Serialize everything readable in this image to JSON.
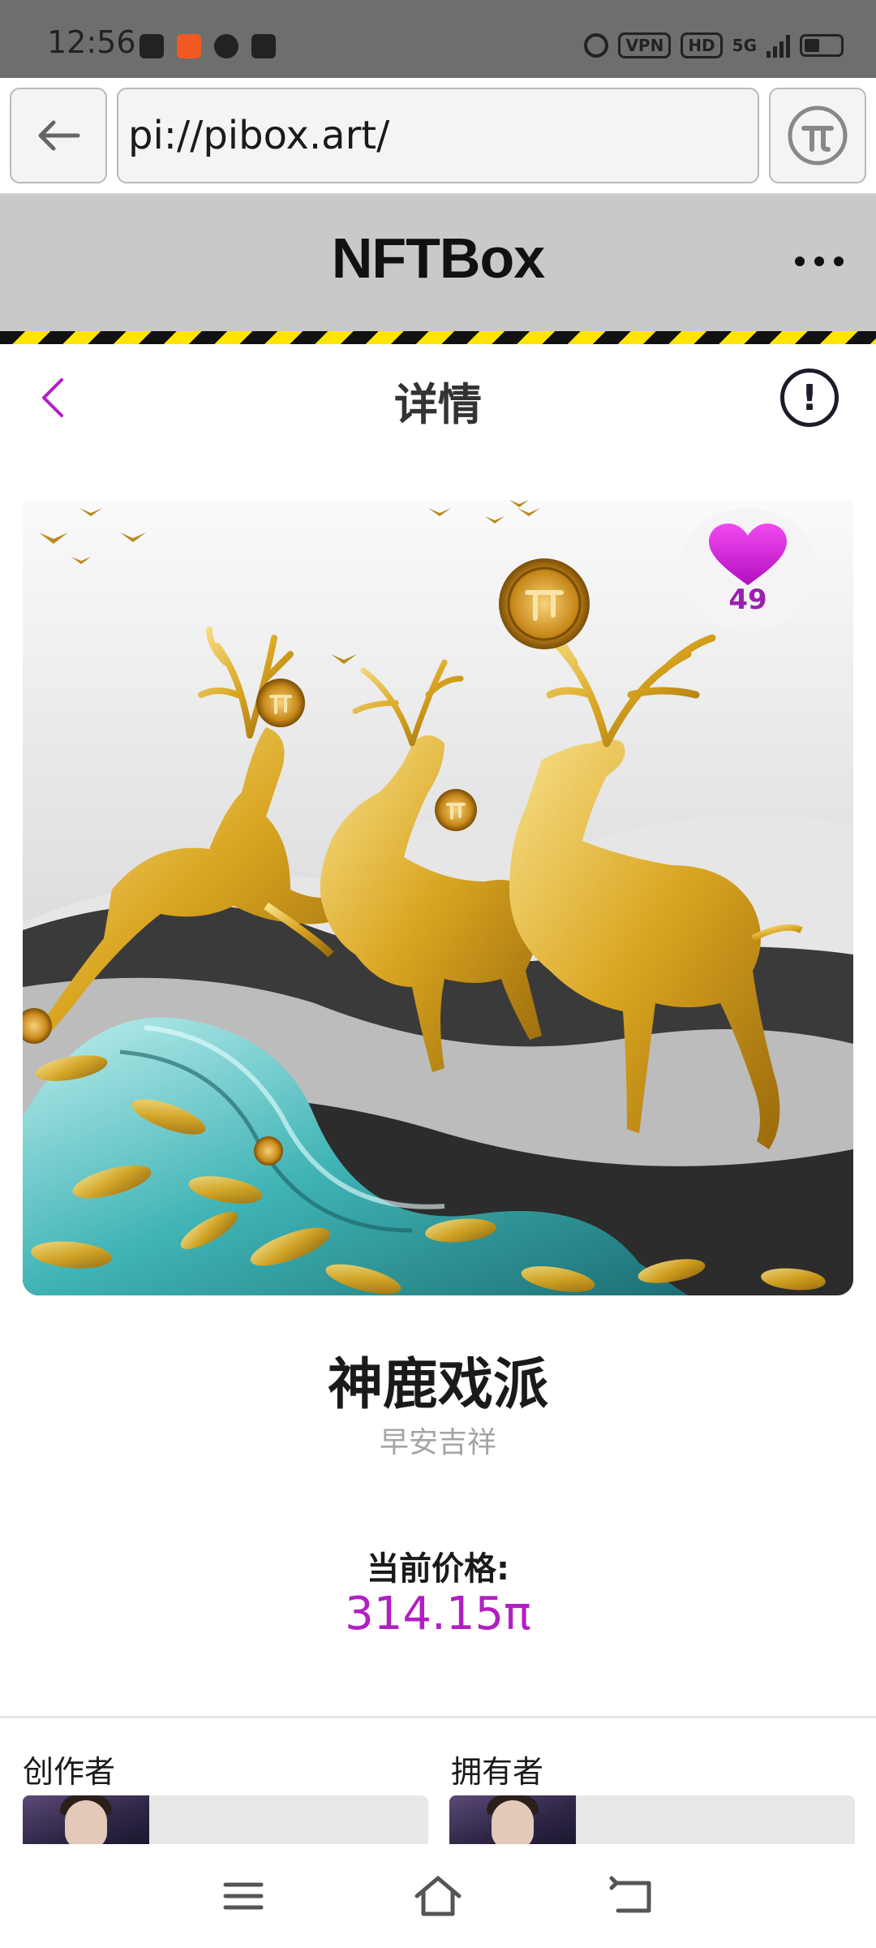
{
  "status_bar": {
    "time": "12:56",
    "badges": [
      "VPN",
      "HD"
    ],
    "network": "5G"
  },
  "browser": {
    "url": "pi://pibox.art/",
    "back_icon": "arrow-left-icon",
    "pi_icon": "pi-logo-icon"
  },
  "app": {
    "title": "NFTBox",
    "more_icon": "more-horizontal-icon"
  },
  "detail": {
    "nav_title": "详情",
    "back_icon": "chevron-left-icon",
    "info_icon": "info-icon",
    "likes": "49",
    "name": "神鹿戏派",
    "subtitle": "早安吉祥",
    "price_label": "当前价格:",
    "price_value": "314.15π",
    "creator_label": "创作者",
    "owner_label": "拥有者"
  },
  "colors": {
    "accent": "#b11fc4",
    "heart": "#d61fd6",
    "header_bg": "#c9c9c9",
    "hazard_yellow": "#ffe400"
  },
  "bottom_nav": {
    "icons": [
      "menu-icon",
      "home-icon",
      "back-icon"
    ]
  }
}
